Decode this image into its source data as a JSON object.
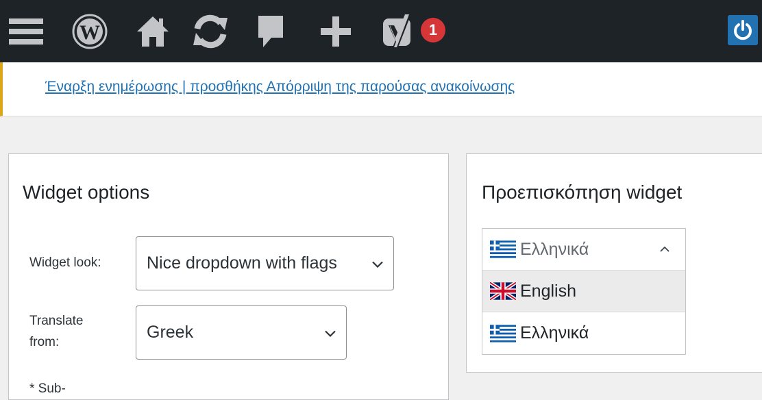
{
  "adminbar": {
    "icons": [
      "menu-icon",
      "wordpress-logo-icon",
      "home-icon",
      "refresh-icon",
      "comment-icon",
      "plus-icon",
      "yoast-logo-icon",
      "power-icon"
    ],
    "notification_count": "1",
    "colors": {
      "bar": "#1d2327",
      "badge": "#d63638",
      "power": "#2271b1"
    }
  },
  "notice": {
    "text": "Έναρξη ενημέρωσης | προσθήκης Απόρριψη της παρούσας ανακοίνωσης",
    "border_color": "#dba617"
  },
  "options": {
    "title": "Widget options",
    "widget_look_label": "Widget look:",
    "widget_look_value": "Nice dropdown with flags",
    "translate_from_label": "Translate\nfrom:",
    "translate_from_value": "Greek",
    "sub_label": "* Sub-"
  },
  "preview": {
    "title": "Προεπισκόπηση widget",
    "selected": "Ελληνικά",
    "options": [
      {
        "label": "English",
        "flag": "uk-flag-icon",
        "highlighted": true
      },
      {
        "label": "Ελληνικά",
        "flag": "greek-flag-icon",
        "highlighted": false
      }
    ]
  }
}
